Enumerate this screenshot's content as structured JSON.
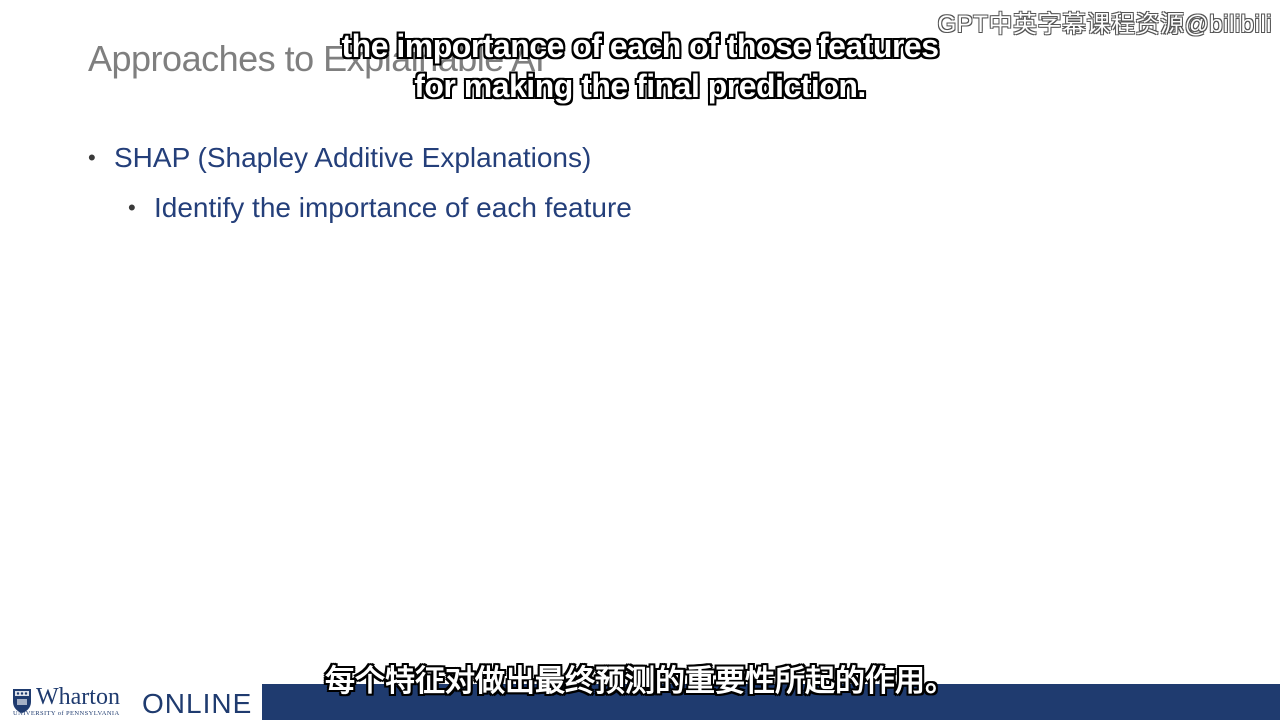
{
  "slide": {
    "title": "Approaches to Explainable AI",
    "bullets": [
      {
        "text": "SHAP (Shapley Additive Explanations)",
        "children": [
          {
            "text": "Identify the importance of each feature"
          }
        ]
      }
    ]
  },
  "watermark": "GPT中英字幕课程资源@bilibili",
  "subtitles": {
    "english": [
      "the importance of each of those features",
      "for making the final prediction."
    ],
    "chinese": "每个特征对做出最终预测的重要性所起的作用。"
  },
  "footer": {
    "logo_name": "Wharton",
    "logo_subline": "UNIVERSITY of PENNSYLVANIA",
    "online_label": "ONLINE",
    "bar_color": "#1f3b6f"
  },
  "icons": {
    "logo_shield": "penn-shield-icon"
  }
}
